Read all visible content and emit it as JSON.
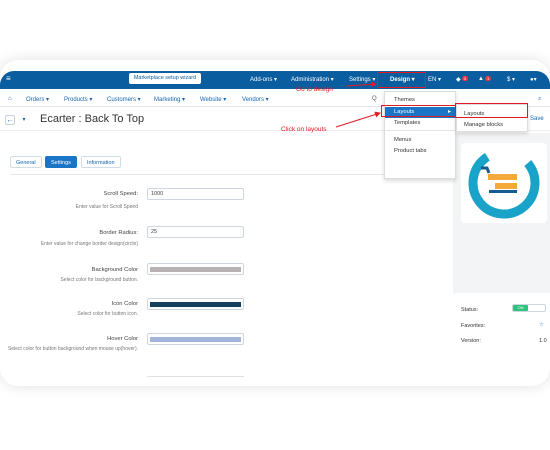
{
  "topbar": {
    "wizard_label": "Marketplace setup wizard",
    "menu_addons": "Add-ons ▾",
    "menu_administration": "Administration ▾",
    "menu_settings": "Settings ▾",
    "menu_design": "Design ▾",
    "lang": "EN ▾",
    "currency": "$ ▾",
    "notif_count_1": "3",
    "notif_count_2": "1"
  },
  "navbar": {
    "orders": "Orders ▾",
    "products": "Products ▾",
    "customers": "Customers ▾",
    "marketing": "Marketing ▾",
    "website": "Website ▾",
    "vendors": "Vendors ▾"
  },
  "page": {
    "title": "Ecarter : Back To Top",
    "save_label": "Save"
  },
  "tabs": [
    {
      "label": "General"
    },
    {
      "label": "Settings"
    },
    {
      "label": "Information"
    }
  ],
  "form": {
    "scroll_speed": {
      "label": "Scroll Speed:",
      "hint": "Enter value for Scroll Speed",
      "value": "1000"
    },
    "border_radius": {
      "label": "Border Radius:",
      "hint": "Enter value for change border design(circle)",
      "value": "25"
    },
    "background_color": {
      "label": "Background Color",
      "hint": "Select color for background button.",
      "color": "#b7b1b4"
    },
    "icon_color": {
      "label": "Icon Color",
      "hint": "Select color for button icon.",
      "color": "#14405c"
    },
    "hover_color": {
      "label": "Hover Color",
      "hint": "Select color for button background when mouse up(hover).",
      "color": "#a3b6da"
    }
  },
  "sidebar_info": {
    "status_label": "Status:",
    "status_value": "ON",
    "favorites_label": "Favorites:",
    "version_label": "Version:",
    "version_value": "1.0"
  },
  "design_menu": {
    "items": [
      "Themes",
      "Layouts",
      "Templates",
      "Menus",
      "Product tabs"
    ]
  },
  "layouts_submenu": {
    "items": [
      "Layouts",
      "Manage blocks"
    ]
  },
  "annotations": {
    "go_to_design": "Go to design",
    "click_on_layouts": "Click on layouts"
  },
  "colors": {
    "topbar": "#0a5ea0",
    "accent": "#1b75c6",
    "annotation": "#e01b24"
  }
}
